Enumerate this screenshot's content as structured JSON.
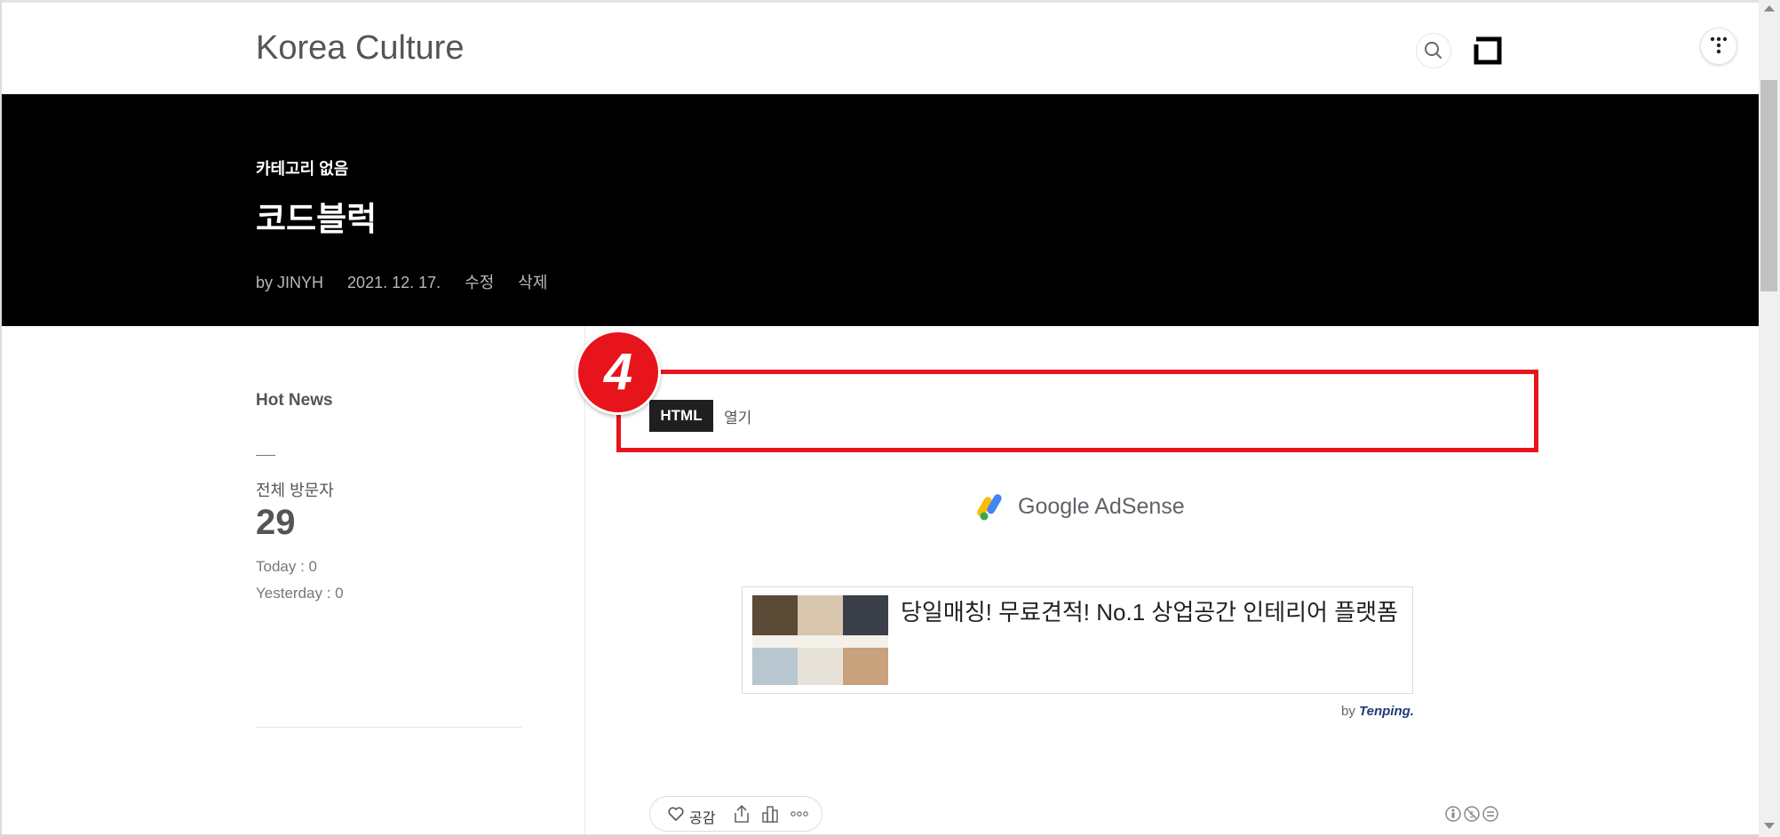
{
  "header": {
    "site_title": "Korea Culture",
    "icons": [
      "search-icon",
      "menu-square-icon",
      "tistory-t-icon"
    ]
  },
  "hero": {
    "category": "카테고리 없음",
    "title": "코드블럭",
    "author": "by JINYH",
    "date": "2021. 12. 17.",
    "edit_label": "수정",
    "delete_label": "삭제"
  },
  "sidebar": {
    "hot_news_label": "Hot News",
    "total_visitors_label": "전체 방문자",
    "total_visitors_value": "29",
    "today_label": "Today : 0",
    "yesterday_label": "Yesterday : 0"
  },
  "annotation": {
    "step_number": "4",
    "color": "#e8141c"
  },
  "code_block": {
    "html_button_label": "HTML",
    "open_label": "열기"
  },
  "ad": {
    "adsense_google": "Google",
    "adsense_product": "AdSense",
    "title": "당일매칭! 무료견적! No.1 상업공간 인테리어 플랫폼",
    "by_label": "by",
    "provider": "Tenping."
  },
  "actions": {
    "like_label": "공감",
    "icons": [
      "heart-icon",
      "share-icon",
      "stats-icon",
      "more-icon",
      "creative-commons-icons"
    ]
  },
  "colors": {
    "hero_bg": "#000000",
    "annotation_red": "#e8141c",
    "html_button_bg": "#1f1f1f"
  }
}
